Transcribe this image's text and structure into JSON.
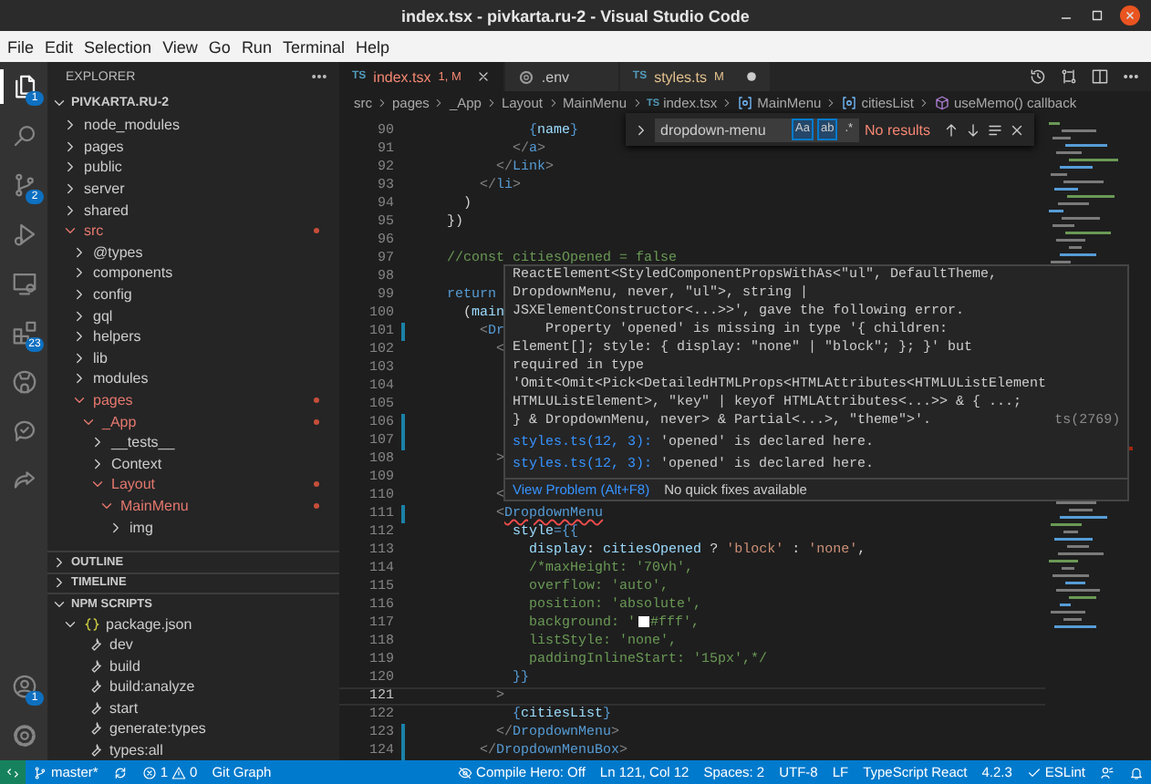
{
  "window": {
    "title": "index.tsx - pivkarta.ru-2 - Visual Studio Code"
  },
  "menu": [
    "File",
    "Edit",
    "Selection",
    "View",
    "Go",
    "Run",
    "Terminal",
    "Help"
  ],
  "activity_bar": {
    "top": [
      {
        "kind": "files",
        "selected": true,
        "badge": "1"
      },
      {
        "kind": "search",
        "selected": false
      },
      {
        "kind": "source-control",
        "selected": false,
        "badge": "2"
      },
      {
        "kind": "run",
        "selected": false
      },
      {
        "kind": "remote",
        "selected": false
      },
      {
        "kind": "extensions",
        "selected": false,
        "badge": "23"
      },
      {
        "kind": "github",
        "selected": false
      },
      {
        "kind": "check",
        "selected": false
      },
      {
        "kind": "share",
        "selected": false
      }
    ],
    "bottom": [
      {
        "kind": "account",
        "selected": false,
        "badge": "1"
      },
      {
        "kind": "settings",
        "selected": false
      }
    ]
  },
  "sidebar": {
    "title": "EXPLORER",
    "folder": "PIVKARTA.RU-2",
    "tree": [
      {
        "label": "node_modules",
        "expanded": false,
        "modified": false
      },
      {
        "label": "pages",
        "expanded": false,
        "modified": false
      },
      {
        "label": "public",
        "expanded": false,
        "modified": false
      },
      {
        "label": "server",
        "expanded": false,
        "modified": false
      },
      {
        "label": "shared",
        "expanded": false,
        "modified": false
      },
      {
        "label": "src",
        "expanded": true,
        "modified": true,
        "children": [
          {
            "label": "@types",
            "expanded": false,
            "modified": false
          },
          {
            "label": "components",
            "expanded": false,
            "modified": false
          },
          {
            "label": "config",
            "expanded": false,
            "modified": false
          },
          {
            "label": "gql",
            "expanded": false,
            "modified": false
          },
          {
            "label": "helpers",
            "expanded": false,
            "modified": false
          },
          {
            "label": "lib",
            "expanded": false,
            "modified": false
          },
          {
            "label": "modules",
            "expanded": false,
            "modified": false
          },
          {
            "label": "pages",
            "expanded": true,
            "modified": true,
            "children": [
              {
                "label": "_App",
                "expanded": true,
                "modified": true,
                "children": [
                  {
                    "label": "__tests__",
                    "expanded": false,
                    "modified": false
                  },
                  {
                    "label": "Context",
                    "expanded": false,
                    "modified": false
                  },
                  {
                    "label": "Layout",
                    "expanded": true,
                    "modified": true,
                    "children": [
                      {
                        "label": "MainMenu",
                        "expanded": true,
                        "modified": true,
                        "children": [
                          {
                            "label": "img",
                            "expanded": false,
                            "modified": false
                          }
                        ]
                      }
                    ]
                  }
                ]
              }
            ]
          }
        ]
      }
    ],
    "panels": [
      {
        "title": "OUTLINE",
        "expanded": false
      },
      {
        "title": "TIMELINE",
        "expanded": false
      },
      {
        "title": "NPM SCRIPTS",
        "expanded": true
      }
    ],
    "npm": {
      "file": "package.json",
      "expanded": true,
      "scripts": [
        "dev",
        "build",
        "build:analyze",
        "start",
        "generate:types",
        "types:all"
      ]
    }
  },
  "tabs": [
    {
      "kind": "ts",
      "icon_text": "TS",
      "label": "index.tsx",
      "badge": "1, M",
      "color": "#f48771",
      "selected": true,
      "dirty": false
    },
    {
      "kind": "settings",
      "label": ".env",
      "color": "#c5c5c5",
      "selected": false,
      "dirty": false
    },
    {
      "kind": "ts",
      "icon_text": "TS",
      "label": "styles.ts",
      "badge": "M",
      "color": "#e2c08d",
      "selected": false,
      "dirty": true
    }
  ],
  "breadcrumbs": [
    {
      "kind": "folder",
      "label": "src"
    },
    {
      "kind": "folder",
      "label": "pages"
    },
    {
      "kind": "folder",
      "label": "_App"
    },
    {
      "kind": "folder",
      "label": "Layout"
    },
    {
      "kind": "folder",
      "label": "MainMenu"
    },
    {
      "kind": "ts",
      "icon_text": "TS",
      "label": "index.tsx"
    },
    {
      "kind": "symbol",
      "label": "MainMenu"
    },
    {
      "kind": "symbol",
      "label": "citiesList"
    },
    {
      "kind": "method",
      "label": "useMemo() callback"
    }
  ],
  "find": {
    "query": "dropdown-menu",
    "options": [
      {
        "label": "Aa",
        "selected": true
      },
      {
        "label": "ab",
        "selected": true
      },
      {
        "label": ".*",
        "selected": false
      }
    ],
    "result": "No results"
  },
  "code": {
    "lines": [
      {
        "number": "90",
        "changed": false,
        "current": false,
        "tokens": [
          {
            "text": "              {",
            "kind": "brace"
          },
          {
            "text": "name",
            "kind": "var"
          },
          {
            "text": "}",
            "kind": "brace"
          }
        ]
      },
      {
        "number": "91",
        "changed": false,
        "current": false,
        "tokens": [
          {
            "text": "            </",
            "kind": "punct"
          },
          {
            "text": "a",
            "kind": "tag"
          },
          {
            "text": ">",
            "kind": "punct"
          }
        ]
      },
      {
        "number": "92",
        "changed": false,
        "current": false,
        "tokens": [
          {
            "text": "          </",
            "kind": "punct"
          },
          {
            "text": "Link",
            "kind": "tag"
          },
          {
            "text": ">",
            "kind": "punct"
          }
        ]
      },
      {
        "number": "93",
        "changed": false,
        "current": false,
        "tokens": [
          {
            "text": "        </",
            "kind": "punct"
          },
          {
            "text": "li",
            "kind": "tag"
          },
          {
            "text": ">",
            "kind": "punct"
          }
        ]
      },
      {
        "number": "94",
        "changed": false,
        "current": false,
        "tokens": [
          {
            "text": "      )",
            "kind": "text"
          }
        ]
      },
      {
        "number": "95",
        "changed": false,
        "current": false,
        "tokens": [
          {
            "text": "    })",
            "kind": "text"
          }
        ]
      },
      {
        "number": "96",
        "changed": false,
        "current": false
      },
      {
        "number": "97",
        "changed": false,
        "current": false,
        "tokens": [
          {
            "text": "    //const citiesOpened = false",
            "kind": "comment"
          }
        ]
      },
      {
        "number": "98",
        "changed": false,
        "current": false
      },
      {
        "number": "99",
        "changed": false,
        "current": false,
        "tokens": [
          {
            "text": "    return",
            "kind": "keyword"
          }
        ]
      },
      {
        "number": "100",
        "changed": false,
        "current": false,
        "tokens": [
          {
            "text": "      (",
            "kind": "text"
          },
          {
            "text": "main",
            "kind": "var"
          }
        ]
      },
      {
        "number": "101",
        "changed": true,
        "current": false,
        "tokens": [
          {
            "text": "        <",
            "kind": "punct"
          },
          {
            "text": "Dr",
            "kind": "tag"
          }
        ]
      },
      {
        "number": "102",
        "changed": false,
        "current": false,
        "tokens": [
          {
            "text": "          <",
            "kind": "punct"
          }
        ]
      },
      {
        "number": "103",
        "changed": false,
        "current": false
      },
      {
        "number": "104",
        "changed": false,
        "current": false
      },
      {
        "number": "105",
        "changed": false,
        "current": false
      },
      {
        "number": "106",
        "changed": true,
        "current": false
      },
      {
        "number": "107",
        "changed": true,
        "current": false
      },
      {
        "number": "108",
        "changed": false,
        "current": false,
        "tokens": [
          {
            "text": "          >",
            "kind": "punct"
          }
        ]
      },
      {
        "number": "109",
        "changed": false,
        "current": false
      },
      {
        "number": "110",
        "changed": false,
        "current": false,
        "tokens": [
          {
            "text": "          <",
            "kind": "punct"
          }
        ]
      },
      {
        "number": "111",
        "changed": true,
        "current": false,
        "tokens": [
          {
            "text": "          <",
            "kind": "punct"
          },
          {
            "text": "DropdownMenu",
            "kind": "tag-error"
          }
        ]
      },
      {
        "number": "112",
        "changed": false,
        "current": false,
        "tokens": [
          {
            "text": "            style",
            "kind": "var"
          },
          {
            "text": "={{",
            "kind": "brace"
          }
        ]
      },
      {
        "number": "113",
        "changed": false,
        "current": false,
        "tokens": [
          {
            "text": "              display",
            "kind": "var"
          },
          {
            "text": ": ",
            "kind": "text"
          },
          {
            "text": "citiesOpened",
            "kind": "var"
          },
          {
            "text": " ? ",
            "kind": "text"
          },
          {
            "text": "'block'",
            "kind": "string"
          },
          {
            "text": " : ",
            "kind": "text"
          },
          {
            "text": "'none'",
            "kind": "string"
          },
          {
            "text": ",",
            "kind": "text"
          }
        ]
      },
      {
        "number": "114",
        "changed": false,
        "current": false,
        "tokens": [
          {
            "text": "              /*maxHeight: '70vh',",
            "kind": "comment"
          }
        ]
      },
      {
        "number": "115",
        "changed": false,
        "current": false,
        "tokens": [
          {
            "text": "              overflow: 'auto',",
            "kind": "comment"
          }
        ]
      },
      {
        "number": "116",
        "changed": false,
        "current": false,
        "tokens": [
          {
            "text": "              position: 'absolute',",
            "kind": "comment"
          }
        ]
      },
      {
        "number": "117",
        "changed": false,
        "current": false,
        "tokens": [
          {
            "text": "              background: '",
            "kind": "comment"
          },
          {
            "kind": "swatch",
            "color": "#ffffff"
          },
          {
            "text": "#fff',",
            "kind": "comment"
          }
        ]
      },
      {
        "number": "118",
        "changed": false,
        "current": false,
        "tokens": [
          {
            "text": "              listStyle: 'none',",
            "kind": "comment"
          }
        ]
      },
      {
        "number": "119",
        "changed": false,
        "current": false,
        "tokens": [
          {
            "text": "              paddingInlineStart: '15px',*/",
            "kind": "comment"
          }
        ]
      },
      {
        "number": "120",
        "changed": false,
        "current": false,
        "tokens": [
          {
            "text": "            }}",
            "kind": "brace"
          }
        ]
      },
      {
        "number": "121",
        "changed": false,
        "current": true,
        "tokens": [
          {
            "text": "          >",
            "kind": "punct"
          }
        ]
      },
      {
        "number": "122",
        "changed": false,
        "current": false,
        "tokens": [
          {
            "text": "            {",
            "kind": "brace"
          },
          {
            "text": "citiesList",
            "kind": "var"
          },
          {
            "text": "}",
            "kind": "brace"
          }
        ]
      },
      {
        "number": "123",
        "changed": true,
        "current": false,
        "tokens": [
          {
            "text": "          </",
            "kind": "punct"
          },
          {
            "text": "DropdownMenu",
            "kind": "tag"
          },
          {
            "text": ">",
            "kind": "punct"
          }
        ]
      },
      {
        "number": "124",
        "changed": true,
        "current": false,
        "tokens": [
          {
            "text": "        </",
            "kind": "punct"
          },
          {
            "text": "DropdownMenuBox",
            "kind": "tag"
          },
          {
            "text": ">",
            "kind": "punct"
          }
        ]
      }
    ]
  },
  "hover": {
    "message": "ReactElement<StyledComponentPropsWithAs<\"ul\", DefaultTheme,\nDropdownMenu, never, \"ul\">, string |\nJSXElementConstructor<...>>', gave the following error.\n    Property 'opened' is missing in type '{ children:\nElement[]; style: { display: \"none\" | \"block\"; }; }' but\nrequired in type\n'Omit<Omit<Pick<DetailedHTMLProps<HTMLAttributes<HTMLUListElement\nHTMLUListElement>, \"key\" | keyof HTMLAttributes<...>> & { ...;\n} & DropdownMenu, never> & Partial<...>, \"theme\">'.",
    "code": "ts(2769)",
    "related": [
      {
        "link": "styles.ts(12, 3):",
        "text": "'opened' is declared here."
      },
      {
        "link": "styles.ts(12, 3):",
        "text": "'opened' is declared here."
      }
    ],
    "action": "View Problem (Alt+F8)",
    "note": "No quick fixes available"
  },
  "status_bar": {
    "left": [
      {
        "kind": "remote"
      },
      {
        "kind": "branch",
        "label": "master*"
      },
      {
        "kind": "sync"
      },
      {
        "kind": "problems",
        "errors": "1",
        "warnings": "0"
      },
      {
        "kind": "text",
        "label": "Git Graph"
      }
    ],
    "right": [
      {
        "kind": "compile",
        "label": "Compile Hero: Off"
      },
      {
        "kind": "text",
        "label": "Ln 121, Col 12"
      },
      {
        "kind": "text",
        "label": "Spaces: 2"
      },
      {
        "kind": "text",
        "label": "UTF-8"
      },
      {
        "kind": "text",
        "label": "LF"
      },
      {
        "kind": "text",
        "label": "TypeScript React"
      },
      {
        "kind": "text",
        "label": "4.2.3"
      },
      {
        "kind": "eslint",
        "label": "ESLint"
      },
      {
        "kind": "feedback"
      },
      {
        "kind": "bell"
      }
    ]
  }
}
